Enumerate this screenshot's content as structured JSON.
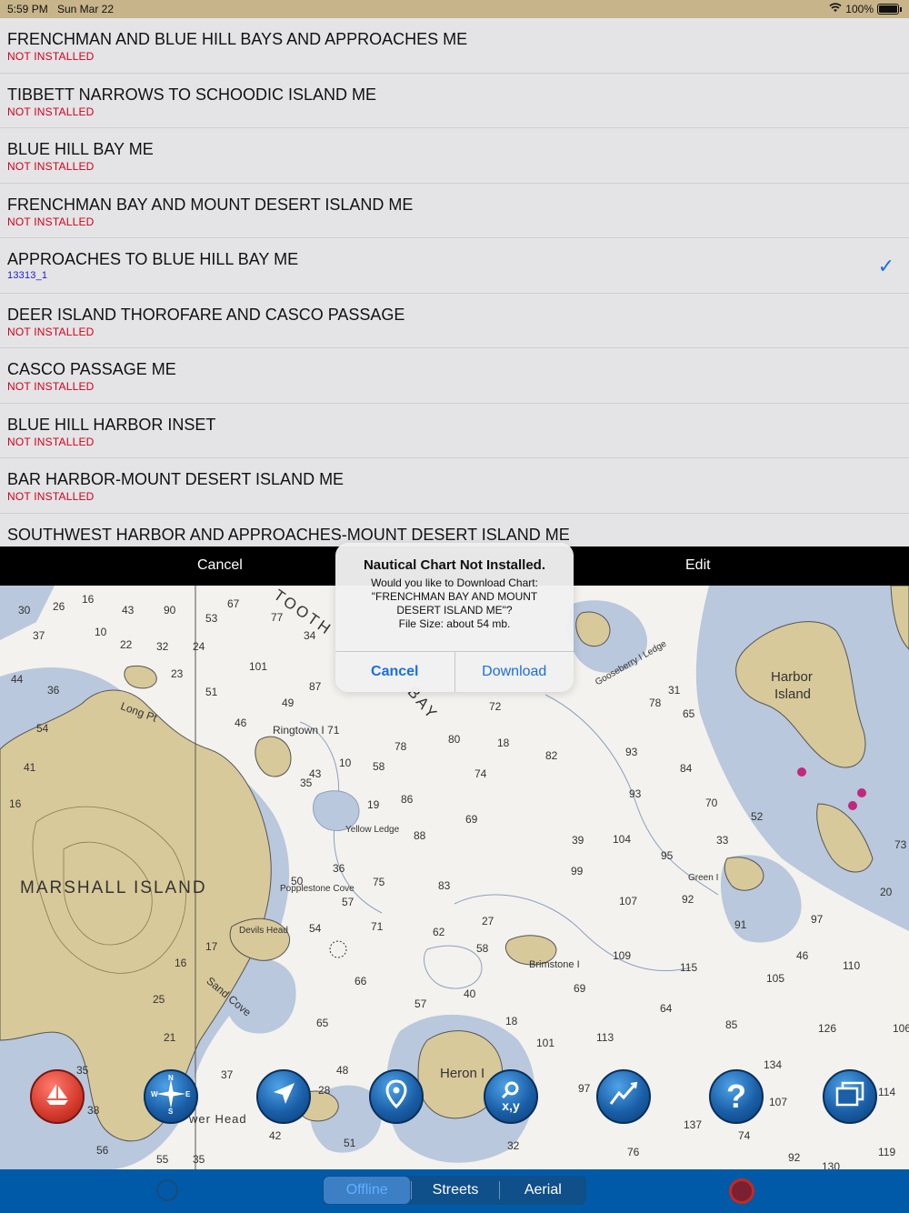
{
  "status": {
    "time": "5:59 PM",
    "date": "Sun Mar 22",
    "battery": "100%"
  },
  "charts": [
    {
      "title": "FRENCHMAN AND BLUE HILL BAYS AND APPROACHES  ME",
      "status": "NOT INSTALLED"
    },
    {
      "title": "TIBBETT NARROWS TO SCHOODIC ISLAND  ME",
      "status": "NOT INSTALLED"
    },
    {
      "title": "BLUE HILL BAY  ME",
      "status": "NOT INSTALLED"
    },
    {
      "title": "FRENCHMAN BAY AND MOUNT DESERT ISLAND  ME",
      "status": "NOT INSTALLED"
    },
    {
      "title": "APPROACHES TO BLUE HILL BAY  ME",
      "status": "13313_1",
      "checked": true
    },
    {
      "title": "DEER ISLAND THOROFARE AND CASCO PASSAGE",
      "status": "NOT INSTALLED"
    },
    {
      "title": "CASCO PASSAGE  ME",
      "status": "NOT INSTALLED"
    },
    {
      "title": "BLUE HILL HARBOR INSET",
      "status": "NOT INSTALLED"
    },
    {
      "title": "BAR HARBOR-MOUNT DESERT ISLAND  ME",
      "status": "NOT INSTALLED"
    },
    {
      "title": "SOUTHWEST HARBOR AND APPROACHES-MOUNT DESERT ISLAND  ME",
      "status": ""
    }
  ],
  "toolbar": {
    "cancel": "Cancel",
    "edit": "Edit"
  },
  "alert": {
    "title": "Nautical Chart Not Installed.",
    "line1": "Would you like to Download Chart:",
    "line2": "\"FRENCHMAN BAY AND MOUNT",
    "line3": "DESERT ISLAND  ME\"?",
    "line4": "File Size: about 54 mb.",
    "cancel": "Cancel",
    "download": "Download"
  },
  "map_labels": {
    "marshall": "MARSHALL ISLAND",
    "harbor1": "Harbor",
    "harbor2": "Island",
    "heron": "Heron I",
    "ringtown": "Ringtown I 71",
    "yellow_ledge": "Yellow Ledge",
    "popplestone": "Popplestone Cove",
    "devils_head": "Devils Head",
    "brimstone": "Brimstone I",
    "long_pt": "Long Pt",
    "sand_cove": "Sand Cove",
    "gooseberry": "Gooseberry I Ledge",
    "bay": "BAY",
    "tooth": "TOOTH",
    "green": "Green I",
    "lower_head": "wer Head",
    "soundings": [
      "30",
      "26",
      "16",
      "43",
      "90",
      "67",
      "53",
      "77",
      "34",
      "37",
      "10",
      "22",
      "32",
      "24",
      "101",
      "87",
      "44",
      "36",
      "23",
      "51",
      "49",
      "46",
      "54",
      "41",
      "43",
      "10",
      "58",
      "78",
      "80",
      "74",
      "82",
      "93",
      "84",
      "16",
      "35",
      "19",
      "86",
      "69",
      "93",
      "70",
      "52",
      "33",
      "73",
      "88",
      "36",
      "75",
      "83",
      "99",
      "107",
      "92",
      "91",
      "97",
      "50",
      "57",
      "71",
      "62",
      "58",
      "109",
      "115",
      "105",
      "110",
      "16",
      "17",
      "27",
      "54",
      "66",
      "40",
      "69",
      "64",
      "85",
      "126",
      "106",
      "25",
      "21",
      "65",
      "18",
      "101",
      "113",
      "134",
      "107",
      "114",
      "35",
      "37",
      "48",
      "28",
      "97",
      "137",
      "74",
      "92",
      "119",
      "38",
      "56",
      "55",
      "35",
      "42",
      "51",
      "32",
      "76",
      "130",
      "45",
      "95",
      "104",
      "39",
      "18",
      "31",
      "65",
      "72",
      "78",
      "20",
      "46",
      "57"
    ]
  },
  "tools": [
    {
      "name": "boat-icon"
    },
    {
      "name": "compass-icon"
    },
    {
      "name": "navigation-arrow-icon"
    },
    {
      "name": "map-pin-icon"
    },
    {
      "name": "search-xy-icon",
      "label": "x,y"
    },
    {
      "name": "route-icon"
    },
    {
      "name": "help-icon",
      "label": "?"
    },
    {
      "name": "windows-icon"
    }
  ],
  "bottom": {
    "offline": "Offline",
    "streets": "Streets",
    "aerial": "Aerial"
  },
  "colors": {
    "land": "#d8c99a",
    "shallow": "#b9c8dc",
    "water": "#f3f2ee",
    "accent": "#1a6fe0",
    "not_installed": "#d0021b"
  }
}
